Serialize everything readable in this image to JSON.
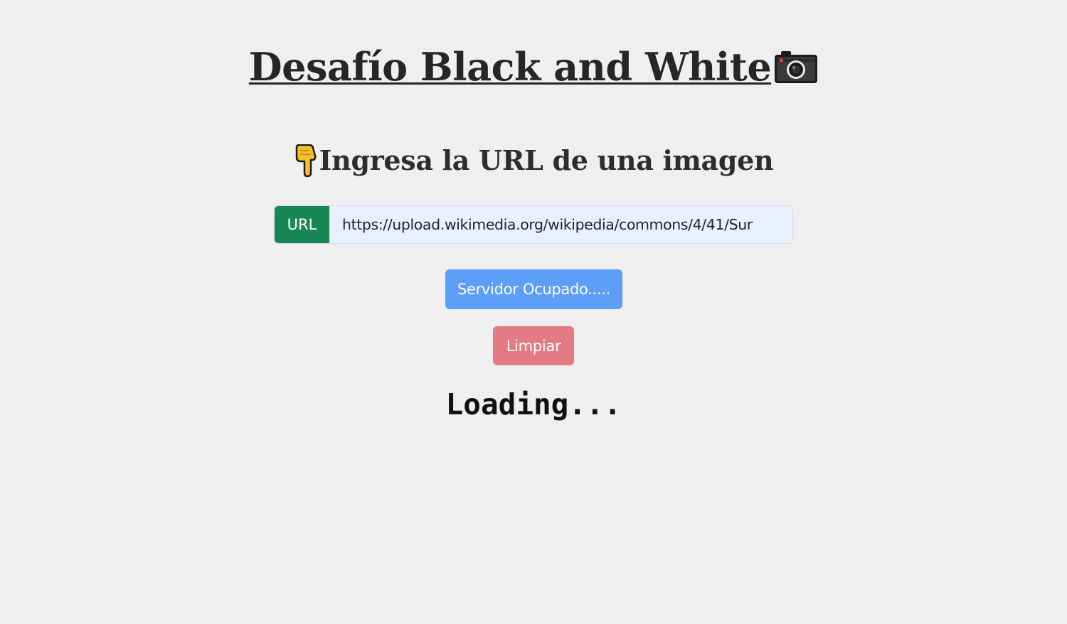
{
  "header": {
    "title": "Desafío Black and White",
    "title_icon": "camera-icon"
  },
  "form": {
    "subtitle": "Ingresa la URL de una imagen",
    "subtitle_icon": "pointing-down-hand-icon",
    "input_label": "URL",
    "url_value": "https://upload.wikimedia.org/wikipedia/commons/4/41/Sur"
  },
  "buttons": {
    "submit_label": "Servidor Ocupado.....",
    "clear_label": "Limpiar"
  },
  "status": {
    "text": "Loading..."
  },
  "colors": {
    "background": "#efefef",
    "url_label_bg": "#198754",
    "submit_bg": "#5c9ef8",
    "clear_bg": "#e47b84",
    "input_bg": "#e8f0fe"
  }
}
